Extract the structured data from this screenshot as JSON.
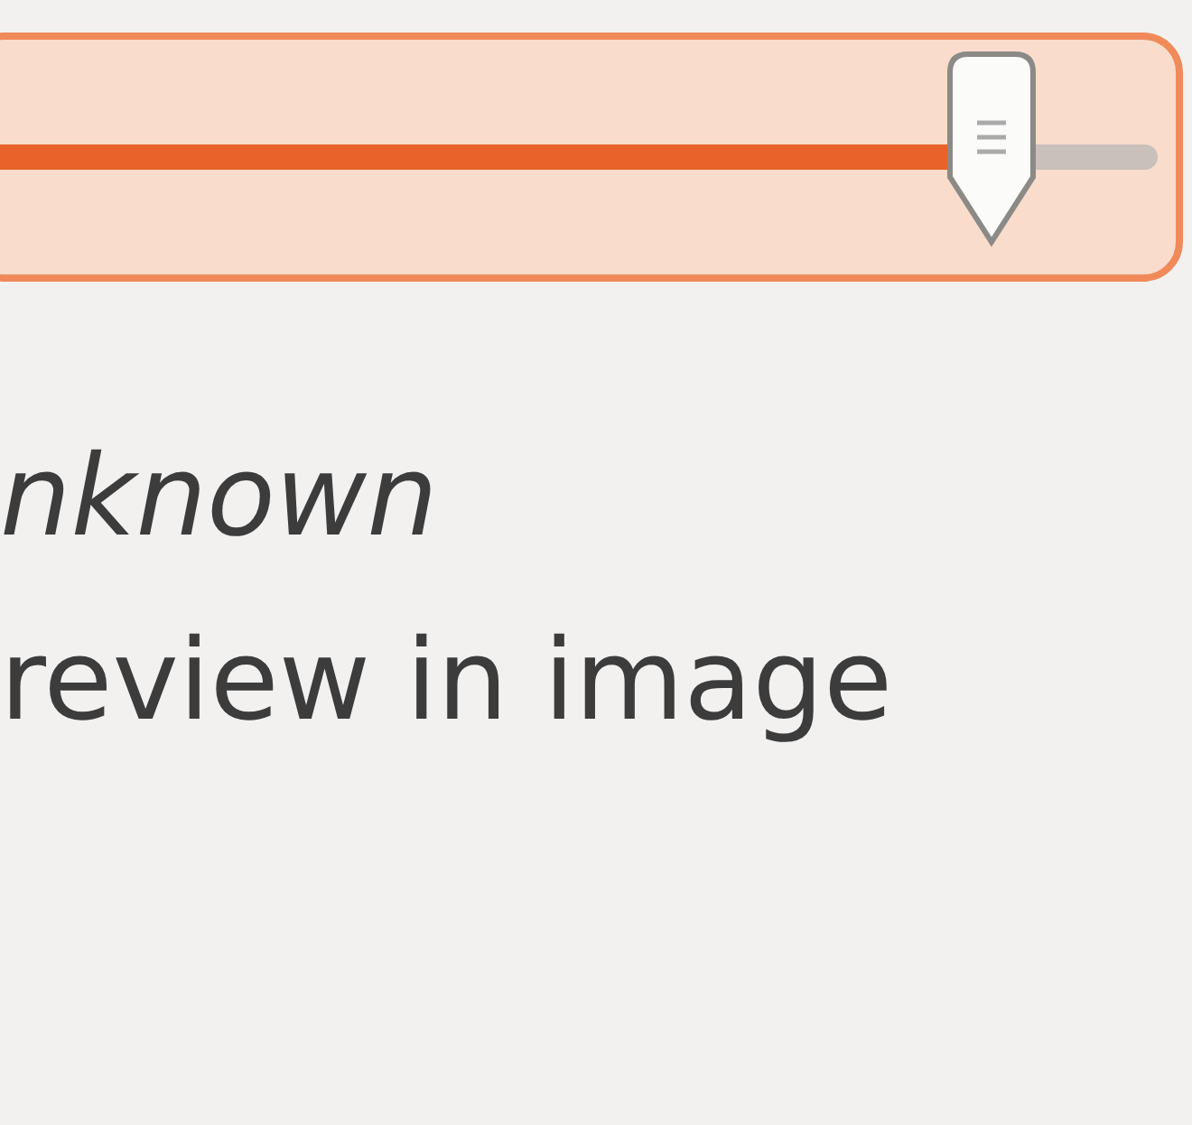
{
  "slider": {
    "level": 0.86,
    "focused": true
  },
  "lines": [
    {
      "text": "nknown",
      "italic": true
    },
    {
      "text": "review in image",
      "italic": false
    }
  ]
}
